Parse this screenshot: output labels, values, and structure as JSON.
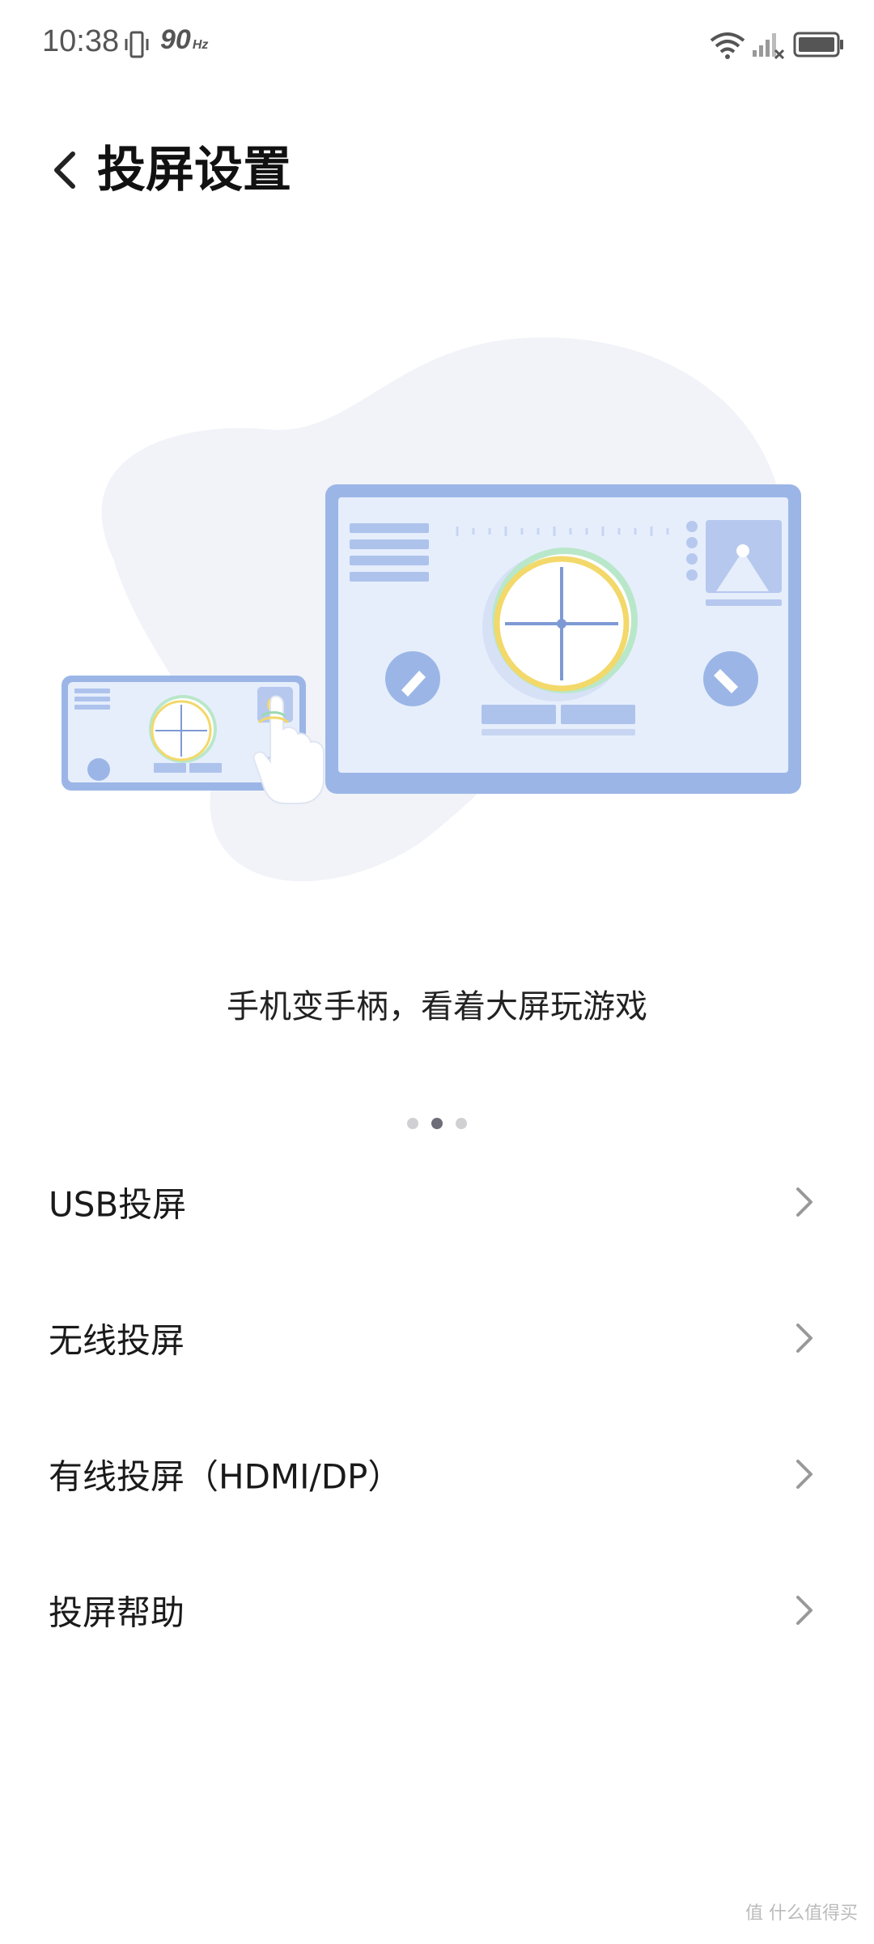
{
  "status_bar": {
    "time": "10:38",
    "refresh_rate": "90",
    "refresh_unit": "Hz",
    "icons": [
      "vibrate-icon",
      "wifi-icon",
      "signal-icon",
      "battery-icon"
    ]
  },
  "header": {
    "title": "投屏设置",
    "back_icon": "chevron-left-icon"
  },
  "carousel": {
    "caption": "手机变手柄，看着大屏玩游戏",
    "page_count": 3,
    "active_page": 2
  },
  "menu": {
    "items": [
      {
        "label": "USB投屏"
      },
      {
        "label": "无线投屏"
      },
      {
        "label": "有线投屏（HDMI/DP）"
      },
      {
        "label": "投屏帮助"
      }
    ]
  },
  "watermark": "值 什么值得买",
  "colors": {
    "illustration_blue": "#9bb6e6",
    "illustration_light": "#e9f0fc",
    "accent_yellow": "#f3d86a",
    "accent_green": "#b9e7c9"
  }
}
